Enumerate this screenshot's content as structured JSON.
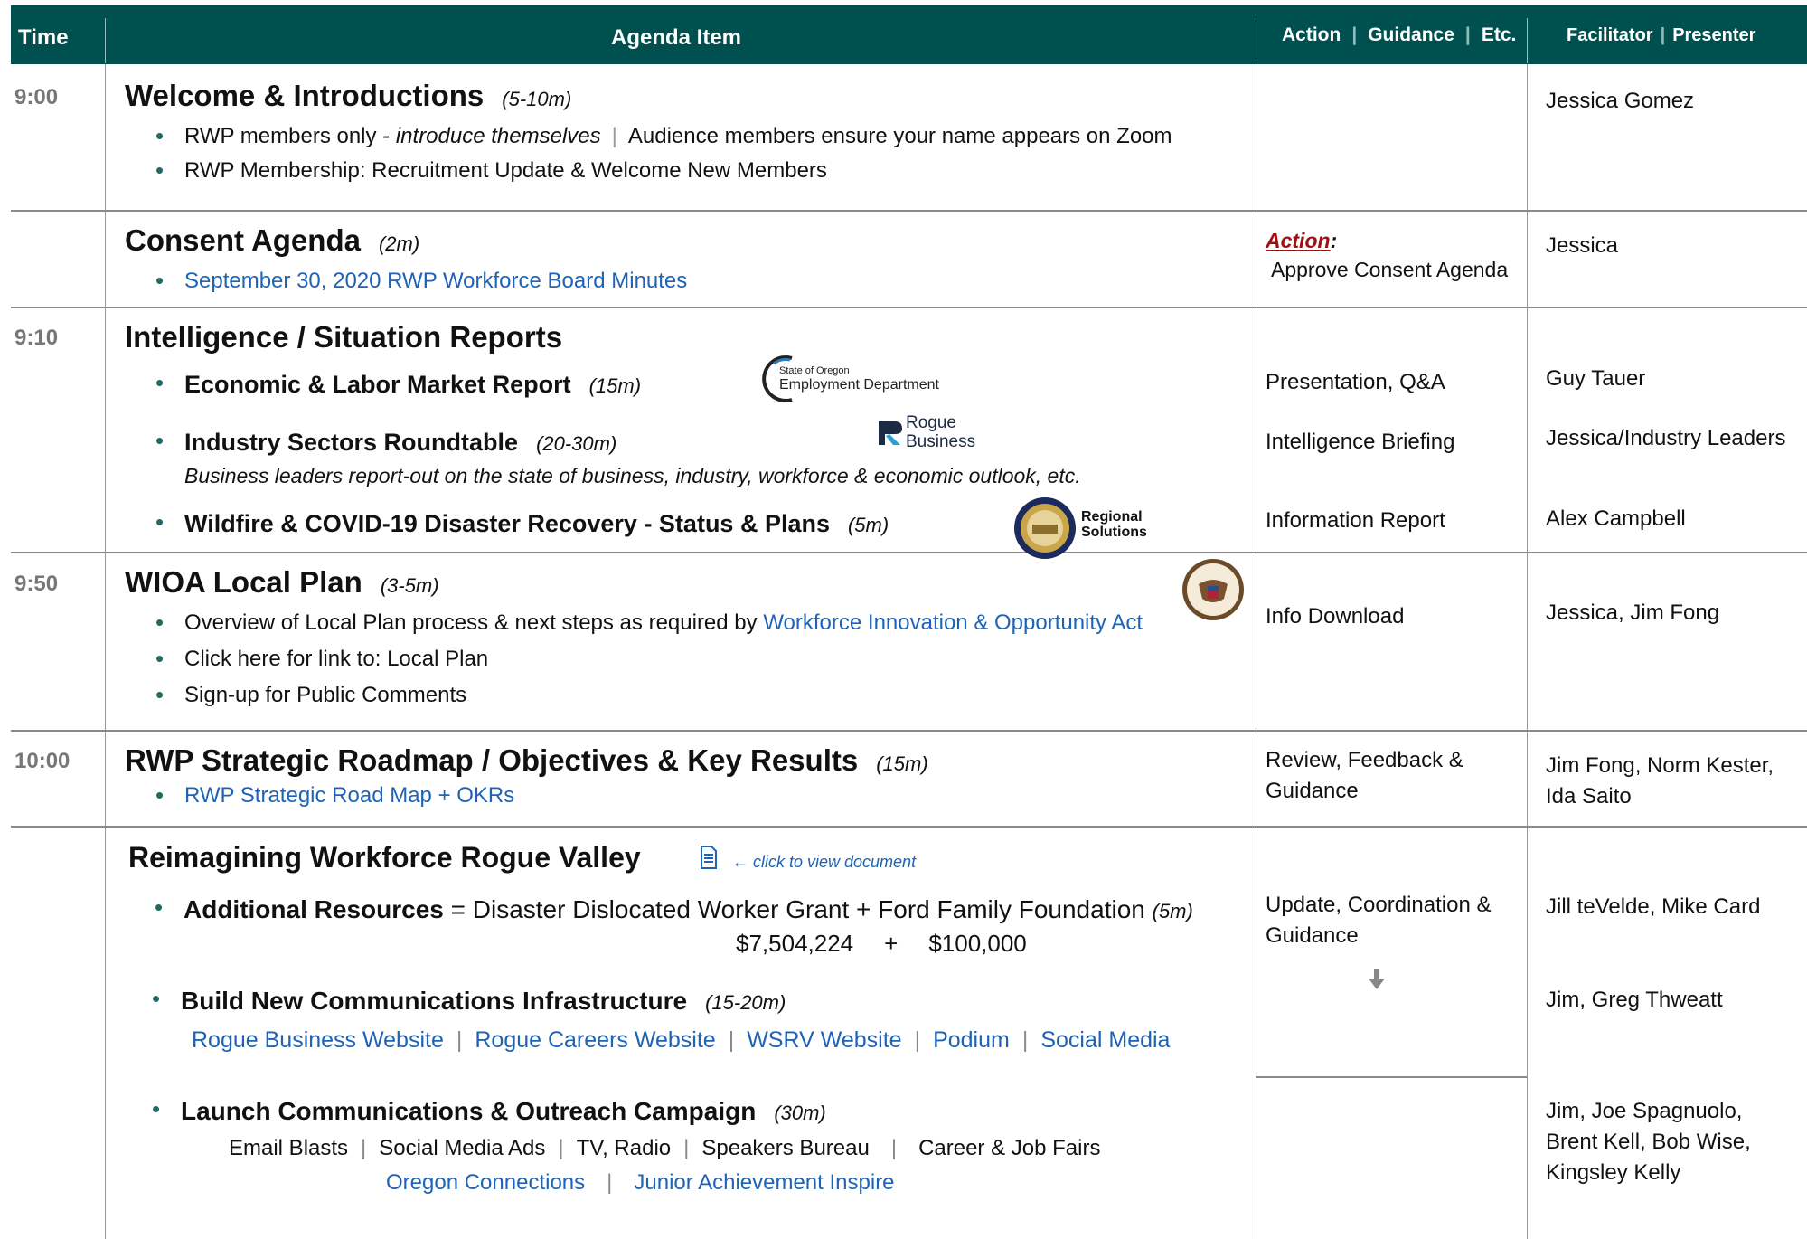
{
  "header": {
    "time": "Time",
    "agenda": "Agenda Item",
    "action_a": "Action",
    "action_b": "Guidance",
    "action_c": "Etc.",
    "fac_a": "Facilitator",
    "fac_b": "Presenter"
  },
  "rows": {
    "welcome": {
      "time": "9:00",
      "title": "Welcome & Introductions",
      "dur": "(5-10m)",
      "b1_a": "RWP members only - ",
      "b1_b": "introduce themselves",
      "b1_c": "Audience members ensure your name appears on Zoom",
      "b2": "RWP Membership: Recruitment Update & Welcome New Members",
      "presenter": "Jessica Gomez"
    },
    "consent": {
      "title": "Consent Agenda",
      "dur": "(2m)",
      "b1": "September 30, 2020 RWP Workforce Board Minutes",
      "action_label": "Action",
      "action_colon": ":",
      "action_text": "Approve Consent Agenda",
      "presenter": "Jessica"
    },
    "intel": {
      "time": "9:10",
      "title": "Intelligence / Situation Reports",
      "b1": "Economic & Labor Market Report",
      "b1_dur": "(15m)",
      "logo1_a": "State of Oregon",
      "logo1_b": "Employment Department",
      "b2": "Industry Sectors Roundtable",
      "b2_dur": "(20-30m)",
      "logo2_a": "Rogue",
      "logo2_b": "Business",
      "b2_sub": "Business leaders report-out on the state of business, industry, workforce & economic outlook, etc.",
      "b3": "Wildfire & COVID-19 Disaster Recovery  -  Status & Plans",
      "b3_dur": "(5m)",
      "logo3_a": "Regional",
      "logo3_b": "Solutions",
      "action1": "Presentation, Q&A",
      "action2": "Intelligence Briefing",
      "action3": "Information Report",
      "pres1": "Guy Tauer",
      "pres2": "Jessica/Industry Leaders",
      "pres3": "Alex Campbell"
    },
    "wioa": {
      "time": "9:50",
      "title": "WIOA Local Plan",
      "dur": "(3-5m)",
      "b1_a": "Overview of Local Plan process & next steps as required by ",
      "b1_link": "Workforce Innovation & Opportunity Act",
      "b2": "Click here for link to: Local Plan",
      "b3": "Sign-up for Public Comments",
      "action": "Info Download",
      "presenter": "Jessica, Jim Fong"
    },
    "roadmap": {
      "time": "10:00",
      "title": "RWP Strategic Roadmap / Objectives & Key Results",
      "dur": "(15m)",
      "b1": "RWP Strategic Road Map + OKRs",
      "action_1": "Review, Feedback &",
      "action_2": "Guidance",
      "pres_1": "Jim Fong, Norm Kester,",
      "pres_2": "Ida Saito"
    },
    "reimagine": {
      "title": "Reimagining Workforce Rogue Valley",
      "doc_note": "← click to view document",
      "b1_bold": "Additional Resources",
      "b1_rest": " = Disaster Dislocated Worker Grant + Ford Family Foundation ",
      "b1_dur": "(5m)",
      "amt1": "$7,504,224",
      "plus": "+",
      "amt2": "$100,000",
      "b2": "Build New Communications Infrastructure",
      "b2_dur": "(15-20m)",
      "links": [
        "Rogue Business Website",
        "Rogue Careers Website",
        "WSRV Website",
        "Podium",
        "Social Media"
      ],
      "b3": "Launch Communications & Outreach Campaign",
      "b3_dur": "(30m)",
      "items": [
        "Email Blasts",
        "Social Media Ads",
        "TV, Radio",
        "Speakers Bureau",
        "Career & Job Fairs"
      ],
      "links2": [
        "Oregon Connections",
        "Junior Achievement Inspire"
      ],
      "action_1": "Update, Coordination &",
      "action_2": "Guidance",
      "pres1": "Jill teVelde, Mike Card",
      "pres2": "Jim, Greg Thweatt",
      "pres3_1": "Jim, Joe Spagnuolo,",
      "pres3_2": "Brent Kell, Bob Wise,",
      "pres3_3": "Kingsley Kelly"
    }
  },
  "icons": {
    "doc": "document-icon",
    "arrow": "arrow-down-icon",
    "seal": "us-seal-icon",
    "oregon_seal": "oregon-seal-icon"
  },
  "colors": {
    "header": "#005050",
    "link": "#1e63b6",
    "action": "#a01010"
  }
}
